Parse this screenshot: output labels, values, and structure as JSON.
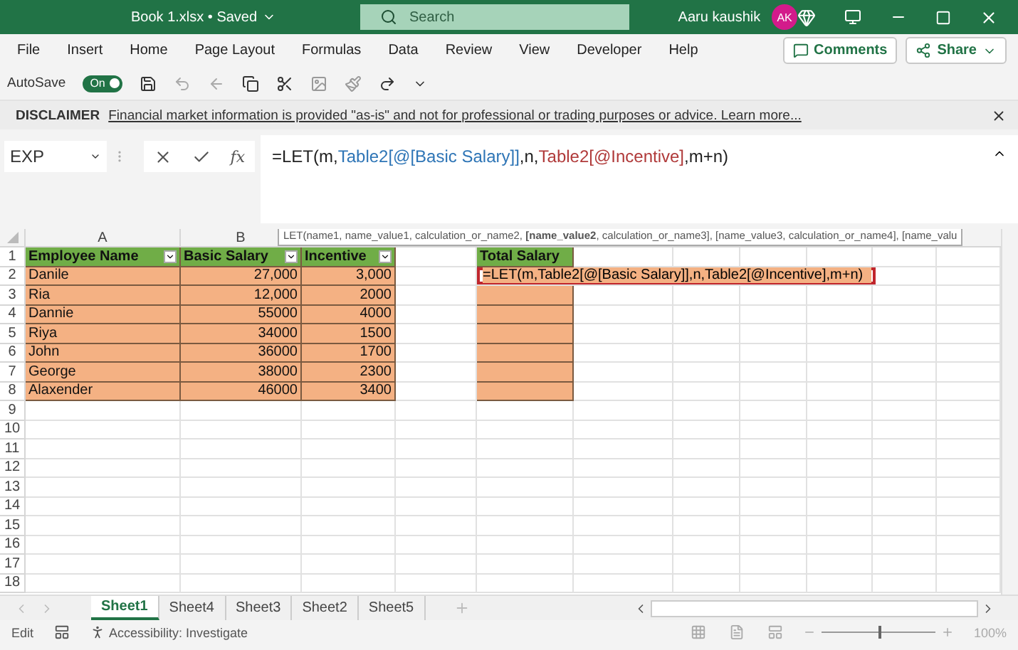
{
  "title_bar": {
    "file_name": "Book 1.xlsx • Saved",
    "search": {
      "placeholder": "Search"
    },
    "user_name": "Aaru kaushik",
    "avatar": "AK"
  },
  "menu": [
    "File",
    "Insert",
    "Home",
    "Page Layout",
    "Formulas",
    "Data",
    "Review",
    "View",
    "Developer",
    "Help"
  ],
  "comments_button": "Comments",
  "share_button": "Share",
  "autosave": {
    "label": "AutoSave",
    "on": true,
    "state_text": "On"
  },
  "disclaimer": {
    "title": "DISCLAIMER",
    "text": "Financial market information is provided \"as-is\" and not for professional or trading purposes or advice. Learn more..."
  },
  "name_box": "EXP",
  "function_button": "fx",
  "formula_bar": {
    "segments": [
      {
        "text": "=LET(m,",
        "color": "#1f1f1f"
      },
      {
        "text": "Table2[@[Basic Salary]]",
        "color": "#2e75b6"
      },
      {
        "text": ",n,",
        "color": "#1f1f1f"
      },
      {
        "text": "Table2[@Incentive]",
        "color": "#b03a3a"
      },
      {
        "text": ",m+n)",
        "color": "#1f1f1f"
      }
    ]
  },
  "column_headers": [
    "A",
    "B"
  ],
  "row_numbers": [
    "1",
    "2",
    "3",
    "4",
    "5",
    "6",
    "7",
    "8",
    "9",
    "10",
    "11",
    "12",
    "13",
    "14",
    "15",
    "16",
    "17",
    "18"
  ],
  "table": {
    "columns": [
      "Employee Name",
      "Basic Salary",
      "Incentive"
    ],
    "rows": [
      [
        "Danile",
        "27,000",
        "3,000"
      ],
      [
        "Ria",
        "12,000",
        "2000"
      ],
      [
        "Dannie",
        "55000",
        "4000"
      ],
      [
        "Riya",
        "34000",
        "1500"
      ],
      [
        "John",
        "36000",
        "1700"
      ],
      [
        "George",
        "38000",
        "2300"
      ],
      [
        "Alaxender",
        "46000",
        "3400"
      ]
    ]
  },
  "total_column": {
    "header": "Total Salary",
    "editing_cell": "=LET(m,Table2[@[Basic Salary]],n,Table2[@Incentive],m+n)"
  },
  "tooltip": "LET(name1, name_value1, calculation_or_name2, **[name_value2**, calculation_or_name3], [name_value3, calculation_or_name4], [name_valu",
  "sheet_tabs": [
    {
      "label": "Sheet1",
      "selected": true
    },
    {
      "label": "Sheet4",
      "selected": false
    },
    {
      "label": "Sheet3",
      "selected": false
    },
    {
      "label": "Sheet2",
      "selected": false
    },
    {
      "label": "Sheet5",
      "selected": false
    }
  ],
  "status_bar": {
    "mode": "Edit",
    "accessibility": "Accessibility: Investigate",
    "zoom": {
      "level": 0.5,
      "reading": "100%"
    }
  }
}
